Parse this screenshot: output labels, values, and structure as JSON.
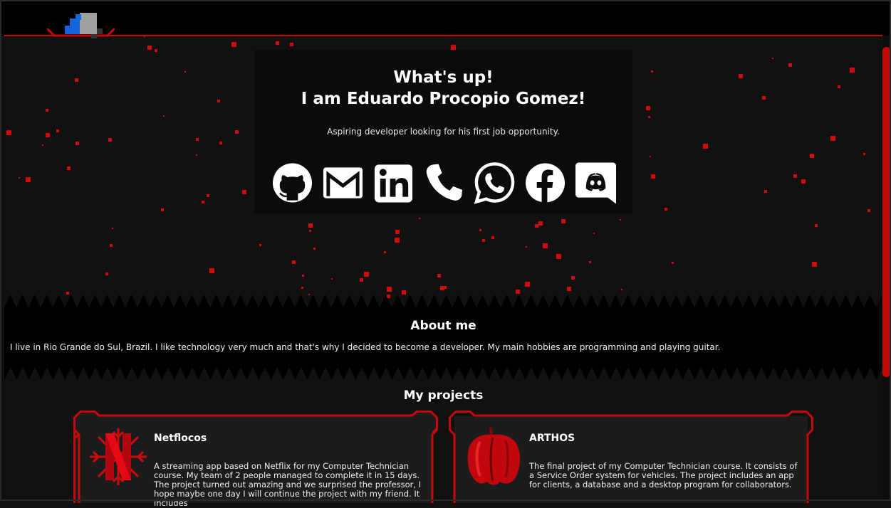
{
  "hero": {
    "greeting": "What's up!",
    "name_line": "I am Eduardo Procopio Gomez!",
    "tagline": "Aspiring developer looking for his first job opportunity."
  },
  "socials": [
    {
      "icon": "github-icon"
    },
    {
      "icon": "gmail-icon"
    },
    {
      "icon": "linkedin-icon"
    },
    {
      "icon": "phone-icon"
    },
    {
      "icon": "whatsapp-icon"
    },
    {
      "icon": "facebook-icon"
    },
    {
      "icon": "discord-icon"
    }
  ],
  "about": {
    "title": "About me",
    "text": "I live in Rio Grande do Sul, Brazil. I like technology very much and that's why I decided to become a developer. My main hobbies are programming and playing guitar."
  },
  "projects": {
    "title": "My projects",
    "items": [
      {
        "name": "Netflocos",
        "description": "A streaming app based on Netflix for my Computer Technician course. My team of 2 people managed to complete it in 15 days. The project turned out amazing and we surprised the professor, I hope maybe one day I will continue the project with my friend. It includes"
      },
      {
        "name": "ARTHOS",
        "description": "The final project of my Computer Technician course. It consists of a Service Order system for vehicles. The project includes an app for clients, a database and a desktop program for collaborators."
      }
    ]
  },
  "colors": {
    "accent": "#c4090d",
    "background": "#111111",
    "panel": "#0b0b0b"
  }
}
